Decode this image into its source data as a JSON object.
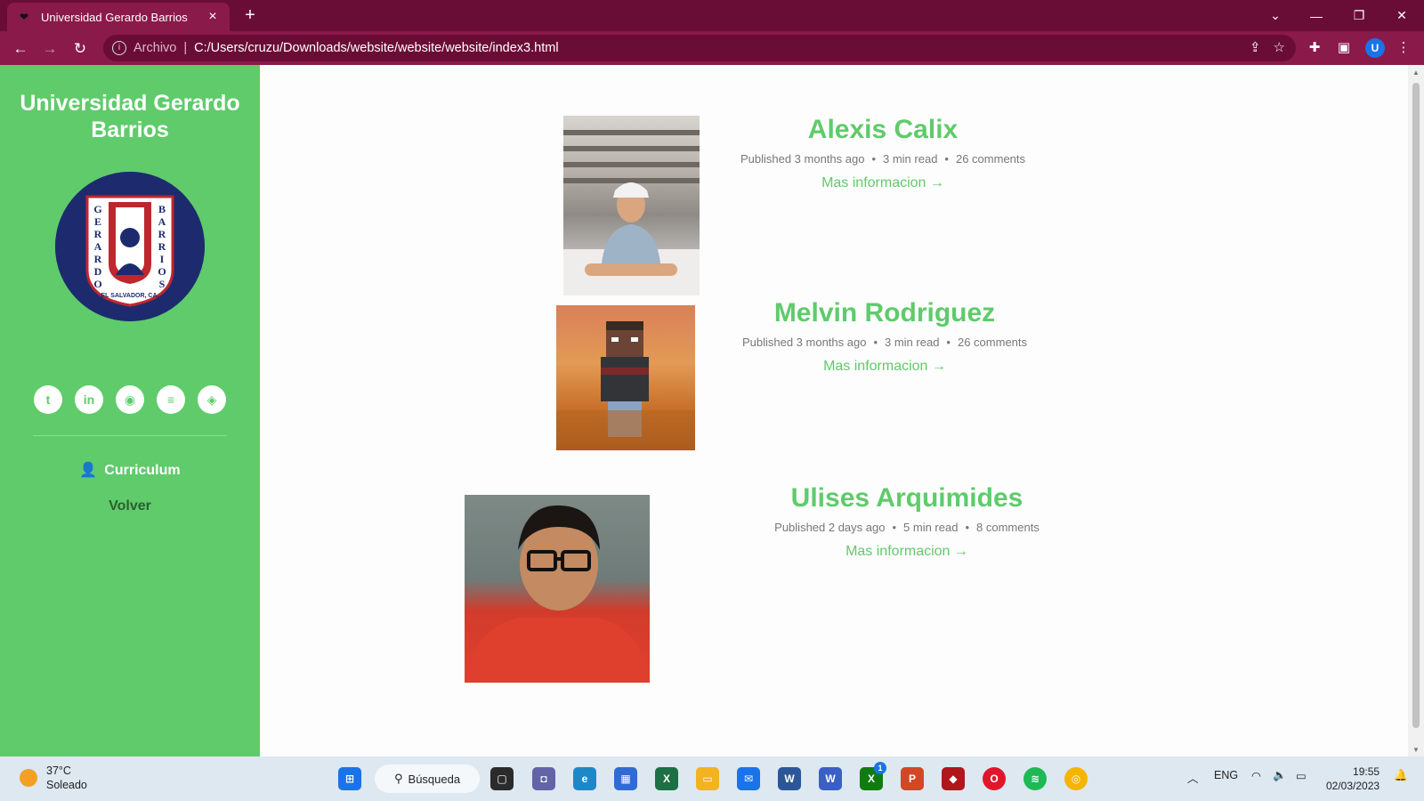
{
  "browser": {
    "tab_title": "Universidad Gerardo Barrios",
    "url_scheme": "Archivo",
    "url_path": "C:/Users/cruzu/Downloads/website/website/website/index3.html",
    "profile_initial": "U"
  },
  "sidebar": {
    "title": "Universidad Gerardo Barrios",
    "logo": {
      "top_letter": "U",
      "left_word": "GERARDO",
      "right_word": "BARRIOS",
      "bottom_text": "EL SALVADOR, C.A."
    },
    "social": [
      "twitter-icon",
      "linkedin-icon",
      "github-icon",
      "stackoverflow-icon",
      "codepen-icon"
    ],
    "menu": [
      {
        "label": "Curriculum",
        "icon": "user-icon"
      },
      {
        "label": "Volver"
      }
    ]
  },
  "posts": [
    {
      "title": "Alexis Calix",
      "published": "Published 3 months ago",
      "read": "3 min read",
      "comments": "26 comments",
      "link": "Mas informacion →"
    },
    {
      "title": "Melvin Rodriguez",
      "published": "Published 3 months ago",
      "read": "3 min read",
      "comments": "26 comments",
      "link": "Mas informacion →"
    },
    {
      "title": "Ulises Arquimides",
      "published": "Published 2 days ago",
      "read": "5 min read",
      "comments": "8 comments",
      "link": "Mas informacion →"
    }
  ],
  "taskbar": {
    "temperature": "37°C",
    "weather": "Soleado",
    "search_label": "Búsqueda",
    "language": "ENG",
    "time": "19:55",
    "date": "02/03/2023",
    "badge_count": "1"
  },
  "colors": {
    "accent": "#5fcb6b",
    "browser_dark": "#6a0d36",
    "browser_light": "#8a1a4a",
    "logo_navy": "#1d2b6e"
  }
}
